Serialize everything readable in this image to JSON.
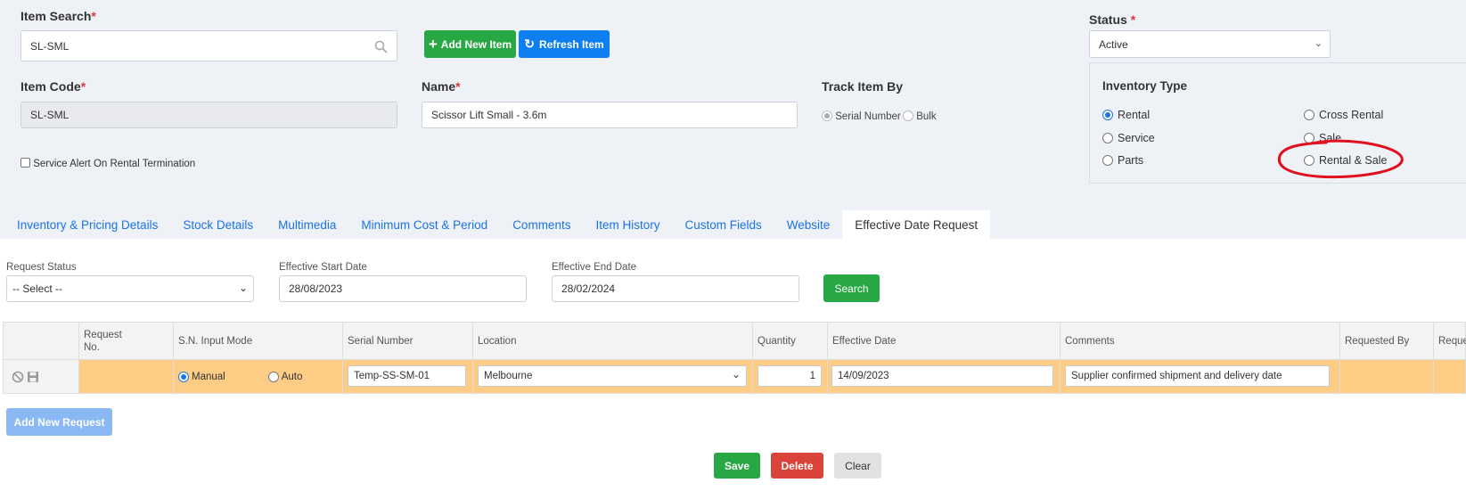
{
  "item_search": {
    "label": "Item Search",
    "required_mark": "*",
    "value": "SL-SML",
    "icon": "search-icon"
  },
  "buttons": {
    "add_new_item": "Add New Item",
    "refresh_item": "Refresh Item",
    "search": "Search",
    "add_new_request": "Add New Request",
    "save": "Save",
    "delete": "Delete",
    "clear": "Clear"
  },
  "status": {
    "label": "Status",
    "required_mark": "*",
    "value": "Active"
  },
  "item_code": {
    "label": "Item Code",
    "required_mark": "*",
    "value": "SL-SML"
  },
  "name": {
    "label": "Name",
    "required_mark": "*",
    "value": "Scissor Lift Small - 3.6m"
  },
  "track_item_by": {
    "label": "Track Item By",
    "options": [
      "Serial Number",
      "Bulk"
    ],
    "selected": "Serial Number"
  },
  "service_alert": {
    "label": "Service Alert On Rental Termination",
    "checked": false
  },
  "inventory_type": {
    "title": "Inventory Type",
    "options": [
      "Rental",
      "Cross Rental",
      "Service",
      "Sale",
      "Parts",
      "Rental & Sale"
    ],
    "selected": "Rental"
  },
  "tabs": [
    {
      "label": "Inventory & Pricing Details"
    },
    {
      "label": "Stock Details"
    },
    {
      "label": "Multimedia"
    },
    {
      "label": "Minimum Cost & Period"
    },
    {
      "label": "Comments"
    },
    {
      "label": "Item History"
    },
    {
      "label": "Custom Fields"
    },
    {
      "label": "Website"
    },
    {
      "label": "Effective Date Request"
    }
  ],
  "active_tab": "Effective Date Request",
  "filters": {
    "request_status": {
      "label": "Request Status",
      "value": "-- Select --"
    },
    "start_date": {
      "label": "Effective Start Date",
      "value": "28/08/2023"
    },
    "end_date": {
      "label": "Effective End Date",
      "value": "28/02/2024"
    }
  },
  "grid": {
    "headers": [
      "",
      "Request\nNo.",
      "S.N. Input Mode",
      "Serial Number",
      "Location",
      "Quantity",
      "Effective Date",
      "Comments",
      "Requested By",
      "Reques"
    ],
    "header_request_no_line1": "Request",
    "header_request_no_line2": "No.",
    "row": {
      "mode_options": [
        "Manual",
        "Auto"
      ],
      "mode_selected": "Manual",
      "serial_number": "Temp-SS-SM-01",
      "location": "Melbourne",
      "quantity": "1",
      "effective_date": "14/09/2023",
      "comments": "Supplier confirmed shipment and delivery date"
    }
  },
  "colors": {
    "green": "#28a745",
    "blue": "#0d7ff0",
    "red": "#d9433a",
    "row_highlight": "#fdcd85",
    "annotation": "#e0101e"
  }
}
